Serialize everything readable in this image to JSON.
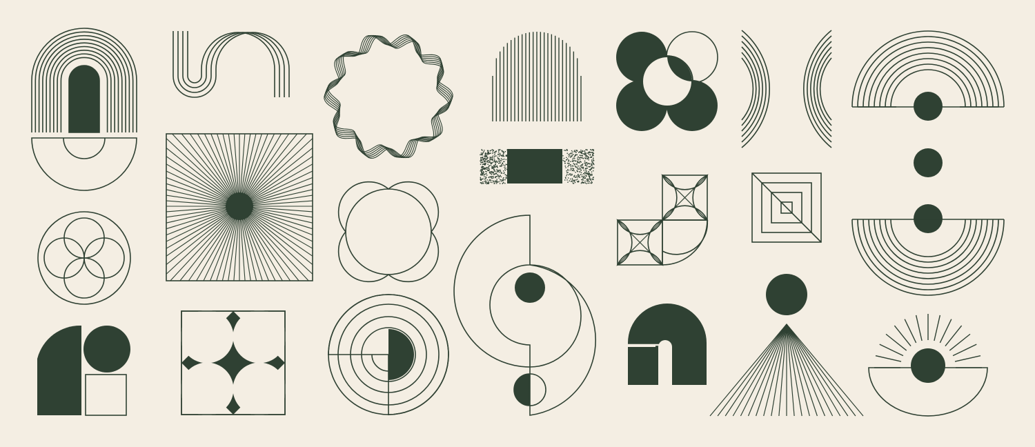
{
  "palette": {
    "background": "#f4eee3",
    "ink": "#2f4133"
  },
  "shapes": [
    "rainbow-arch-icon",
    "s-curve-lines-icon",
    "wavy-ring-icon",
    "striped-dome-icon",
    "four-circle-flower-icon",
    "crossing-arcs-icon",
    "concentric-half-arch-icon",
    "half-circle-bowl-icon",
    "sunburst-square-icon",
    "gradient-bar-icon",
    "circle-quatrefoil-icon",
    "tile-stars-icon",
    "nested-squares-icon",
    "three-dot-column-icon",
    "concentric-bowl-icon",
    "yin-yang-s-icon",
    "petal-rosette-icon",
    "arch-and-squares-icon",
    "square-with-star-icon",
    "target-rings-icon",
    "block-arch-icon",
    "pyramid-rays-icon",
    "sunrise-eye-icon"
  ]
}
